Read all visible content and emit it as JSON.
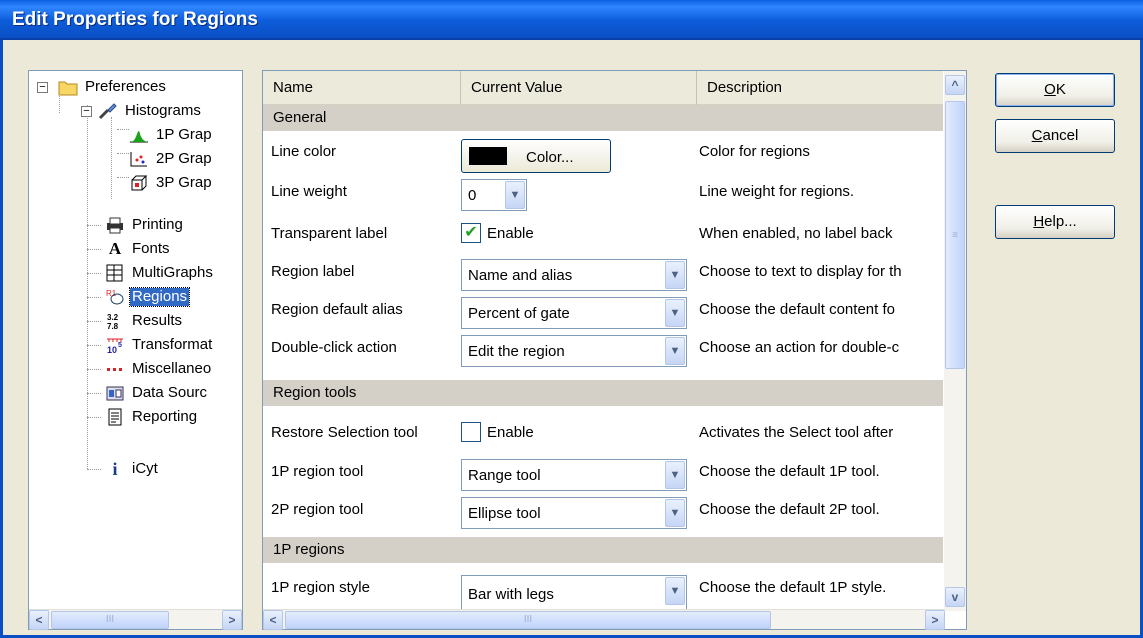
{
  "window": {
    "title": "Edit Properties for Regions"
  },
  "tree": {
    "items": [
      {
        "label": "Preferences",
        "icon": "folder-icon",
        "expander": "−"
      },
      {
        "label": "Histograms",
        "icon": "brush-icon",
        "expander": "−"
      },
      {
        "label": "1P Grap",
        "icon": "1p-graph-icon"
      },
      {
        "label": "2P Grap",
        "icon": "2p-graph-icon"
      },
      {
        "label": "3P Grap",
        "icon": "3p-graph-icon"
      },
      {
        "label": "Printing",
        "icon": "printer-icon"
      },
      {
        "label": "Fonts",
        "icon": "font-icon",
        "glyph": "A"
      },
      {
        "label": "MultiGraphs",
        "icon": "multigraph-icon"
      },
      {
        "label": "Regions",
        "icon": "regions-icon",
        "selected": true
      },
      {
        "label": "Results",
        "icon": "results-icon"
      },
      {
        "label": "Transformat",
        "icon": "transformation-icon"
      },
      {
        "label": "Miscellaneo",
        "icon": "miscellaneous-icon"
      },
      {
        "label": "Data Sourc",
        "icon": "data-source-icon"
      },
      {
        "label": "Reporting",
        "icon": "reporting-icon"
      },
      {
        "label": "iCyt",
        "icon": "info-icon",
        "glyph": "i"
      }
    ]
  },
  "grid": {
    "columns": [
      "Name",
      "Current Value",
      "Description"
    ],
    "sections": [
      {
        "title": "General",
        "rows": [
          {
            "name": "Line color",
            "type": "color",
            "value": "Color...",
            "swatch": "#000000",
            "description": "Color for regions"
          },
          {
            "name": "Line weight",
            "type": "combo",
            "value": "0",
            "description": "Line weight for regions."
          },
          {
            "name": "Transparent label",
            "type": "checkbox",
            "checked": true,
            "value": "Enable",
            "description": "When enabled, no label back"
          },
          {
            "name": "Region label",
            "type": "combo",
            "value": "Name and alias",
            "description": "Choose to text to display for th"
          },
          {
            "name": "Region default alias",
            "type": "combo",
            "value": "Percent of gate",
            "description": "Choose the default content fo"
          },
          {
            "name": "Double-click action",
            "type": "combo",
            "value": "Edit the region",
            "description": "Choose an action for double-c"
          }
        ]
      },
      {
        "title": "Region tools",
        "rows": [
          {
            "name": "Restore Selection tool",
            "type": "checkbox",
            "checked": false,
            "value": "Enable",
            "description": "Activates the Select tool after"
          },
          {
            "name": "1P region tool",
            "type": "combo",
            "value": "Range tool",
            "description": "Choose the default 1P tool."
          },
          {
            "name": "2P region tool",
            "type": "combo",
            "value": "Ellipse tool",
            "description": "Choose the default 2P tool."
          }
        ]
      },
      {
        "title": "1P regions",
        "rows": [
          {
            "name": "1P region style",
            "type": "combo",
            "value": "Bar with legs",
            "description": "Choose the default 1P style."
          }
        ]
      }
    ]
  },
  "buttons": {
    "ok": {
      "pre": "",
      "ul": "O",
      "post": "K"
    },
    "cancel": {
      "pre": "",
      "ul": "C",
      "post": "ancel"
    },
    "help": {
      "pre": "",
      "ul": "H",
      "post": "elp..."
    }
  },
  "scroll": {
    "arrow_left": "<",
    "arrow_right": ">",
    "arrow_up": "^",
    "arrow_down": "v",
    "grip": "III"
  }
}
